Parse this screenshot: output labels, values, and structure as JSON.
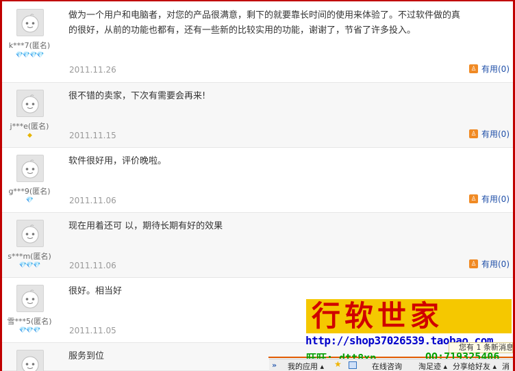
{
  "reviews": [
    {
      "user": "k***7(匿名)",
      "badge": "💎💎💎💎",
      "badge_type": "red",
      "text": "做为一个用户和电脑者，对您的产品很满意，剩下的就要靠长时间的使用来体验了。不过软件做的真的很好，从前的功能也都有，还有一些新的比较实用的功能，谢谢了，节省了许多投入。",
      "date": "2011.11.26",
      "useful": "有用(0)"
    },
    {
      "user": "j***e(匿名)",
      "badge": "◆",
      "badge_type": "gold",
      "text": "很不错的卖家，下次有需要会再来!",
      "date": "2011.11.15",
      "useful": "有用(0)"
    },
    {
      "user": "g***9(匿名)",
      "badge": "💎",
      "badge_type": "red",
      "text": "软件很好用，评价晚啦。",
      "date": "2011.11.06",
      "useful": "有用(0)"
    },
    {
      "user": "s***m(匿名)",
      "badge": "💎💎💎",
      "badge_type": "red",
      "text": "现在用着还可 以，期待长期有好的效果",
      "date": "2011.11.06",
      "useful": "有用(0)"
    },
    {
      "user": "雪***5(匿名)",
      "badge": "💎💎💎",
      "badge_type": "red",
      "text": "很好。相当好",
      "date": "2011.11.05",
      "useful": ""
    },
    {
      "user": "",
      "badge": "",
      "badge_type": "red",
      "text": "服务到位",
      "date": "",
      "useful": ""
    }
  ],
  "watermark": {
    "title": "行软世家",
    "url": "http://shop37026539.taobao.com",
    "wangwang": "旺旺: dtt8xp",
    "qq": "QQ:719325406"
  },
  "notice": "您有 1 条新消息",
  "toolbar": {
    "arrow": "»",
    "apps": "我的应用 ▴",
    "consult": "在线咨询",
    "footprint": "淘足迹 ▴",
    "share": "分享给好友 ▴",
    "msg": "消"
  },
  "colors": {
    "frame": "#c00000",
    "link": "#1f4fa8",
    "date": "#999999"
  }
}
